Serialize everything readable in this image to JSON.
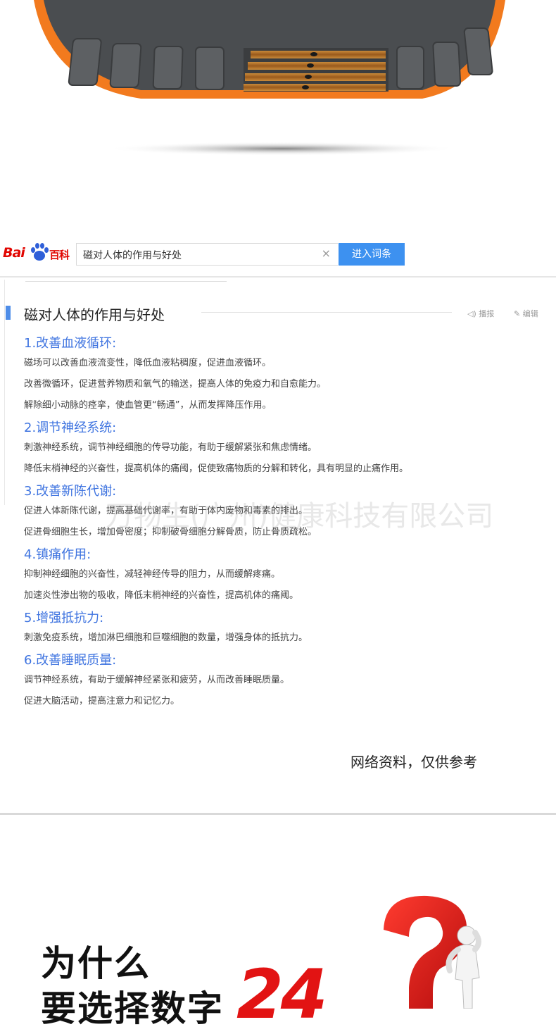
{
  "baike": {
    "logo_bai": "Bai",
    "logo_baike": "百科",
    "search_value": "磁对人体的作用与好处",
    "clear_symbol": "×",
    "enter_button": "进入词条"
  },
  "article": {
    "title": "磁对人体的作用与好处",
    "broadcast": "播报",
    "edit": "编辑",
    "sections": [
      {
        "heading": "1.改善血液循环:",
        "lines": [
          "磁场可以改善血液流变性，降低血液粘稠度，促进血液循环。",
          "改善微循环，促进营养物质和氧气的输送，提高人体的免疫力和自愈能力。",
          "解除细小动脉的痉挛，使血管更“畅通”，从而发挥降压作用。"
        ]
      },
      {
        "heading": "2.调节神经系统:",
        "lines": [
          "刺激神经系统，调节神经细胞的传导功能，有助于缓解紧张和焦虑情绪。",
          "降低末梢神经的兴奋性，提高机体的痛阈，促使致痛物质的分解和转化，具有明显的止痛作用。"
        ]
      },
      {
        "heading": "3.改善新陈代谢:",
        "lines": [
          "促进人体新陈代谢，提高基础代谢率，有助于体内废物和毒素的排出。",
          "促进骨细胞生长，增加骨密度；抑制破骨细胞分解骨质，防止骨质疏松。"
        ]
      },
      {
        "heading": "4.镇痛作用:",
        "lines": [
          "抑制神经细胞的兴奋性，减轻神经传导的阻力，从而缓解疼痛。",
          "加速炎性渗出物的吸收，降低末梢神经的兴奋性，提高机体的痛阈。"
        ]
      },
      {
        "heading": "5.增强抵抗力:",
        "lines": [
          "刺激免疫系统，增加淋巴细胞和巨噬细胞的数量，增强身体的抵抗力。"
        ]
      },
      {
        "heading": "6.改善睡眠质量:",
        "lines": [
          "调节神经系统，有助于缓解神经紧张和疲劳，从而改善睡眠质量。",
          "促进大脑活动，提高注意力和记忆力。"
        ]
      }
    ]
  },
  "watermark": "万物生(广州)健康科技有限公司",
  "disclaimer": "网络资料，仅供参考",
  "bottom": {
    "line1": "为什么",
    "line2": "要选择数字",
    "number": "24"
  },
  "colors": {
    "accent_blue": "#3f74e0",
    "button_blue": "#3d91f0",
    "band_orange": "#f27a1e",
    "brand_red": "#e10601",
    "number_red": "#e21313"
  }
}
